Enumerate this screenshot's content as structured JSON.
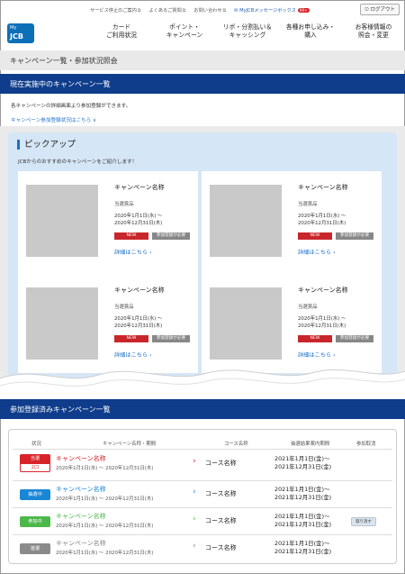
{
  "header": {
    "top_links": [
      {
        "label": "サービス停止のご案内",
        "ext": "⧉"
      },
      {
        "label": "よくあるご質問",
        "ext": "⧉"
      },
      {
        "label": "お問い合わせ",
        "ext": "⧉"
      },
      {
        "label": "MyJCBメッセージボックス",
        "ext": "",
        "badge": "99+"
      }
    ],
    "logout_label": "ログアウト",
    "logo_top": "My",
    "logo_bottom": "JCB"
  },
  "nav": [
    {
      "line1": "カード",
      "line2": "ご利用状況"
    },
    {
      "line1": "ポイント・",
      "line2": "キャンペーン"
    },
    {
      "line1": "リボ・分割払い＆",
      "line2": "キャッシング"
    },
    {
      "line1": "各種お申し込み・",
      "line2": "購入"
    },
    {
      "line1": "お客様情報の",
      "line2": "照会・変更"
    }
  ],
  "page_title": "キャンペーン一覧・参加状況照会",
  "current_section": {
    "title": "現在実施中のキャンペーン一覧",
    "intro": "各キャンペーンの詳細画面より参加登録ができます。",
    "registration_link": "キャンペーン参加登録状況はこちら ∨"
  },
  "pickup": {
    "title": "ピックアップ",
    "subtitle": "JCBからのおすすめのキャンペーンをご紹介します！",
    "cards": [
      {
        "name": "キャンペーン名称",
        "prize": "当選賞品",
        "date1": "2020年1月1日(水) ～",
        "date2": "2020年12月31日(木)",
        "new": "NEW",
        "required": "参加登録が必要",
        "detail": "詳細はこちら ›"
      },
      {
        "name": "キャンペーン名称",
        "prize": "当選賞品",
        "date1": "2020年1月1日(水) ～",
        "date2": "2020年12月31日(木)",
        "new": "NEW",
        "required": "参加登録が必要",
        "detail": "詳細はこちら ›"
      },
      {
        "name": "キャンペーン名称",
        "prize": "当選賞品",
        "date1": "2020年1月1日(水) ～",
        "date2": "2020年12月31日(木)",
        "new": "NEW",
        "required": "参加登録が必要",
        "detail": "詳細はこちら ›"
      },
      {
        "name": "キャンペーン名称",
        "prize": "当選賞品",
        "date1": "2020年1月1日(水) ～",
        "date2": "2020年12月31日(木)",
        "new": "NEW",
        "required": "参加登録が必要",
        "detail": "詳細はこちら ›"
      }
    ]
  },
  "registered_section": {
    "title": "参加登録済みキャンペーン一覧",
    "headers": [
      "状況",
      "キャンペーン名称・期間",
      "コース名称",
      "抽選結果案内期間",
      "参加取消"
    ],
    "rows": [
      {
        "status": "当選",
        "status_sub": "2口",
        "status_color": "#d8232a",
        "name": "キャンペーン名称",
        "name_color": "#d8232a",
        "period": "2020年1月1日(水) ～ 2020年12月31日(木)",
        "course": "コース名称",
        "result1": "2021年1月1日(金)～",
        "result2": "2021年12月31日(金)",
        "cancel": ""
      },
      {
        "status": "抽選中",
        "status_sub": "",
        "status_color": "#1a86d6",
        "name": "キャンペーン名称",
        "name_color": "#1a86d6",
        "period": "2020年1月1日(水) ～ 2020年12月31日(木)",
        "course": "コース名称",
        "result1": "2021年1月1日(金)～",
        "result2": "2021年12月31日(金)",
        "cancel": ""
      },
      {
        "status": "参加中",
        "status_sub": "",
        "status_color": "#4cb84a",
        "name": "キャンペーン名称",
        "name_color": "#4cb84a",
        "period": "2020年1月1日(水) ～ 2020年12月31日(木)",
        "course": "コース名称",
        "result1": "2021年1月1日(金)～",
        "result2": "2021年12月31日(金)",
        "cancel": "取り消す"
      },
      {
        "status": "落選",
        "status_sub": "",
        "status_color": "#8a8a8a",
        "name": "キャンペーン名称",
        "name_color": "#888888",
        "period": "2020年1月1日(水) ～ 2020年12月31日(木)",
        "course": "コース名称",
        "result1": "2021年1月1日(金)～",
        "result2": "2021年12月31日(金)",
        "cancel": ""
      }
    ]
  },
  "colors": {
    "brand_blue": "#0f3d8c",
    "link_blue": "#1d6fc7",
    "pickup_bg": "#d5e6f6"
  }
}
